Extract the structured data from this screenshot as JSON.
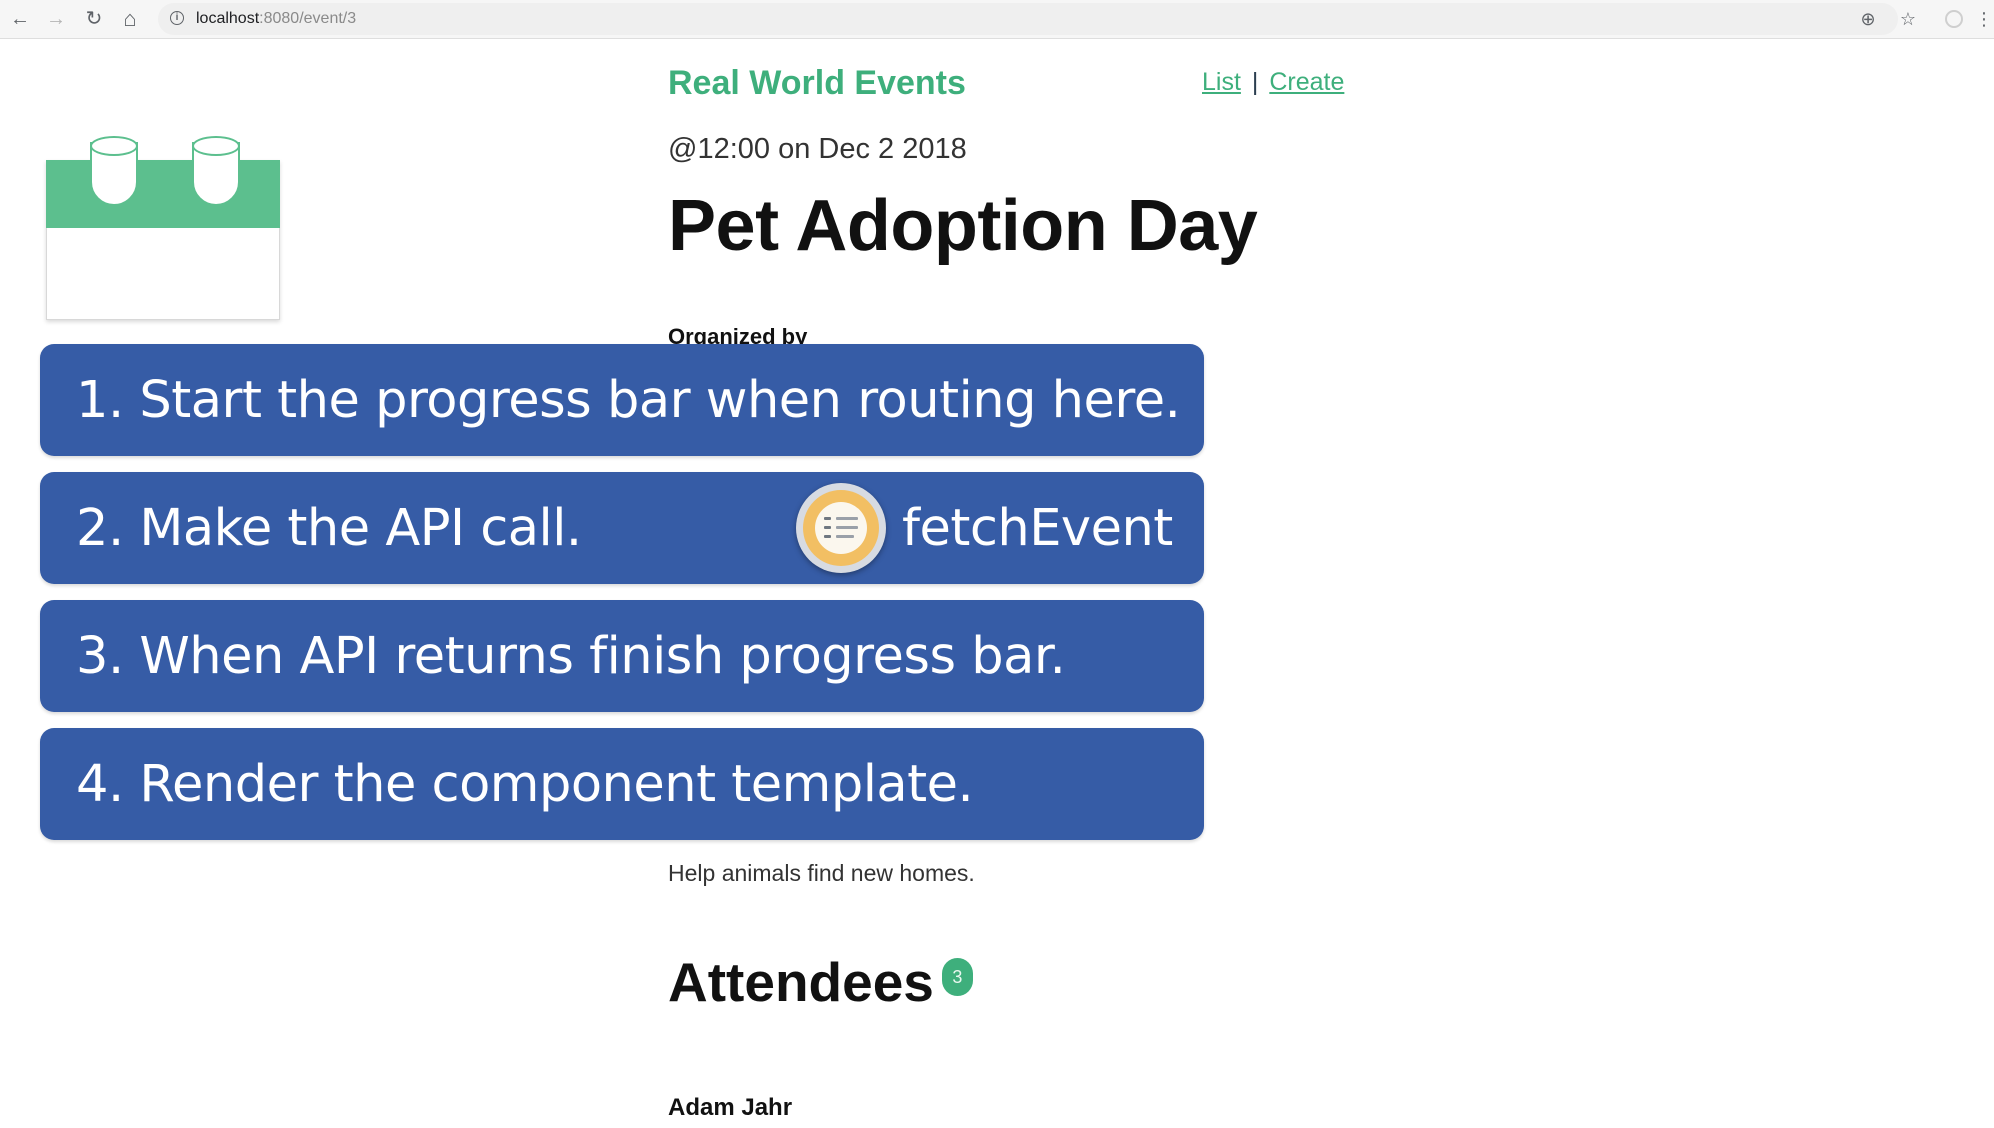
{
  "browser": {
    "url_host": "localhost",
    "url_path": ":8080/event/3",
    "back_glyph": "←",
    "forward_glyph": "→",
    "reload_glyph": "↻",
    "home_glyph": "⌂",
    "zoom_glyph": "⊕",
    "star_glyph": "☆",
    "menu_glyph": "⋮"
  },
  "header": {
    "brand": "Real World Events",
    "nav_list": "List",
    "nav_separator": "|",
    "nav_create": "Create"
  },
  "event": {
    "datetime": "@12:00 on Dec 2 2018",
    "title": "Pet Adoption Day",
    "organized_by": "Organized by",
    "description": "Help animals find new homes.",
    "attendees_heading": "Attendees",
    "attendee_count": "3",
    "attendees": [
      "Adam Jahr"
    ]
  },
  "steps": [
    {
      "text": "1. Start the progress bar when routing here."
    },
    {
      "text": "2. Make the API call.",
      "extra_label": "fetchEvent",
      "extra_icon": "checklist-icon"
    },
    {
      "text": "3. When API returns finish progress bar."
    },
    {
      "text": "4. Render the component template."
    }
  ],
  "colors": {
    "accent": "#3eaf7c",
    "step_background": "#365ca6",
    "calendar_green": "#5cbf8e",
    "fetch_icon_gold": "#f2bf63"
  }
}
